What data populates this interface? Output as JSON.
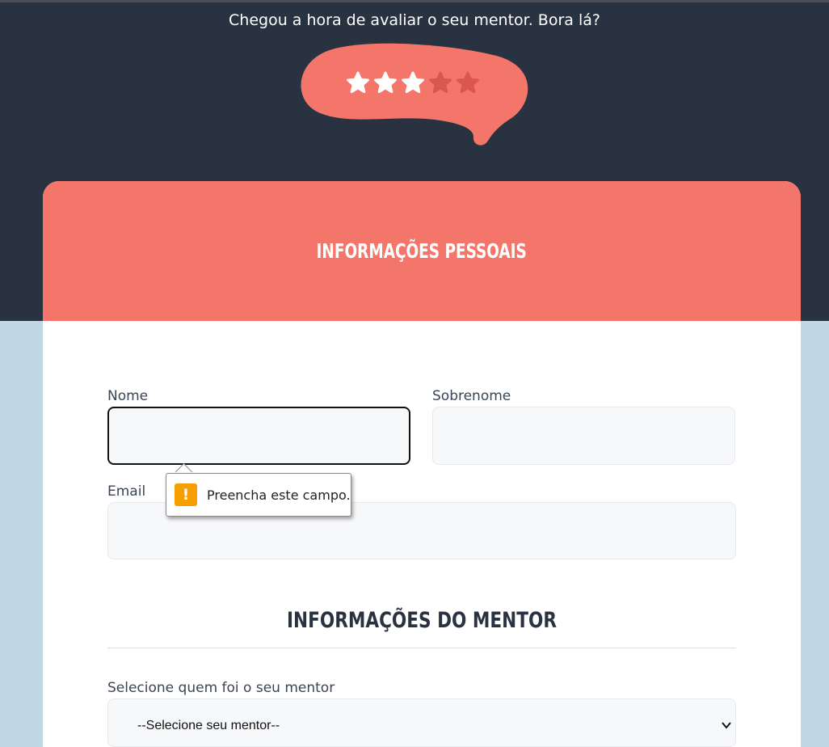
{
  "header": {
    "prompt": "Chegou a hora de avaliar o seu mentor. Bora lá?",
    "rating": {
      "value": 3,
      "max": 5,
      "filled_color": "#ffffff",
      "empty_color": "#d9574c",
      "bubble_color": "#f4766a"
    }
  },
  "personal_section": {
    "title": "Informações pessoais",
    "first_name": {
      "label": "Nome",
      "value": ""
    },
    "last_name": {
      "label": "Sobrenome",
      "value": ""
    },
    "email": {
      "label": "Email",
      "value": ""
    },
    "validation_tooltip": {
      "icon": "warning-icon",
      "text": "Preencha este campo.",
      "icon_label": "!"
    }
  },
  "mentor_section": {
    "title": "Informações do mentor",
    "select_label": "Selecione quem foi o seu mentor",
    "select_value": "--Selecione seu mentor--"
  },
  "colors": {
    "dark_bg": "#293241",
    "accent": "#f4766a",
    "page_bg": "#c1d8e4",
    "warning": "#f59f00"
  }
}
